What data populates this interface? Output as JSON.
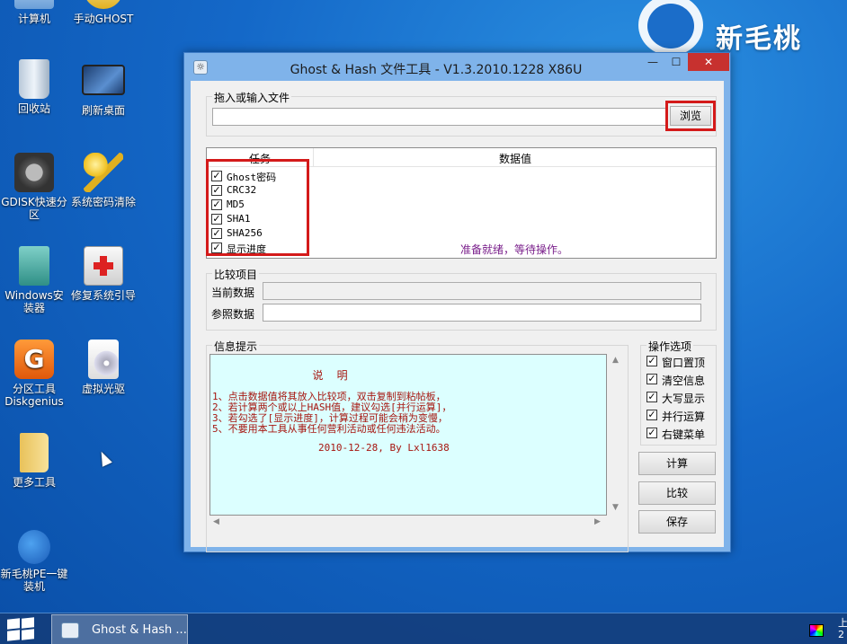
{
  "desktop": {
    "icons": [
      {
        "label": "计算机",
        "icon": "computer-icon"
      },
      {
        "label": "手动GHOST",
        "icon": "ghost-icon"
      },
      {
        "label": "回收站",
        "icon": "recycle-bin-icon"
      },
      {
        "label": "刷新桌面",
        "icon": "monitor-icon"
      },
      {
        "label": "GDISK快速分区",
        "icon": "gdisk-gear-icon"
      },
      {
        "label": "系统密码清除",
        "icon": "key-icon"
      },
      {
        "label": "Windows安装器",
        "icon": "windows-installer-icon"
      },
      {
        "label": "修复系统引导",
        "icon": "first-aid-kit-icon"
      },
      {
        "label": "分区工具Diskgenius",
        "icon": "diskgenius-icon"
      },
      {
        "label": "虚拟光驱",
        "icon": "virtual-cd-icon"
      },
      {
        "label": "更多工具",
        "icon": "folder-icon"
      },
      {
        "label": "新毛桃PE一键装机",
        "icon": "peach-icon"
      }
    ]
  },
  "brand": {
    "text": "新毛桃"
  },
  "window": {
    "title": "Ghost & Hash 文件工具 - V1.3.2010.1228 X86U",
    "controls": {
      "min": "—",
      "max": "☐",
      "close": "✕"
    },
    "file_group": {
      "label": "拖入或输入文件",
      "input_value": "",
      "browse_label": "浏览"
    },
    "table": {
      "headers": [
        "任务",
        "数据值"
      ],
      "rows": [
        {
          "label": "Ghost密码",
          "checked": true,
          "value": ""
        },
        {
          "label": "CRC32",
          "checked": true,
          "value": ""
        },
        {
          "label": "MD5",
          "checked": true,
          "value": ""
        },
        {
          "label": "SHA1",
          "checked": true,
          "value": ""
        },
        {
          "label": "SHA256",
          "checked": true,
          "value": ""
        },
        {
          "label": "显示进度",
          "checked": true,
          "value": "准备就绪，等待操作。"
        }
      ]
    },
    "compare_group": {
      "label": "比较项目",
      "current_label": "当前数据",
      "current_value": "",
      "reference_label": "参照数据",
      "reference_value": ""
    },
    "info_group": {
      "label": "信息提示",
      "title": "说 明",
      "lines": [
        "1、点击数据值将其放入比较项，双击复制到粘帖板，",
        "2、若计算两个或以上HASH值，建议勾选[并行运算]，",
        "3、若勾选了[显示进度]，计算过程可能会稍为变慢，",
        "5、不要用本工具从事任何营利活动或任何违法活动。"
      ],
      "signature": "2010-12-28, By Lxl1638"
    },
    "options_group": {
      "label": "操作选项",
      "options": [
        {
          "label": "窗口置顶",
          "checked": true
        },
        {
          "label": "清空信息",
          "checked": true
        },
        {
          "label": "大写显示",
          "checked": true
        },
        {
          "label": "并行运算",
          "checked": true
        },
        {
          "label": "右键菜单",
          "checked": true
        }
      ]
    },
    "buttons": {
      "compute": "计算",
      "compare": "比较",
      "save": "保存"
    }
  },
  "taskbar": {
    "task_label": "Ghost & Hash ...",
    "clock_top": "上",
    "clock_bottom": "2"
  },
  "colors": {
    "highlight_box": "#d41a1a",
    "info_background": "#dcffff",
    "info_text": "#a6150f",
    "status_text": "#7a1f8b"
  }
}
